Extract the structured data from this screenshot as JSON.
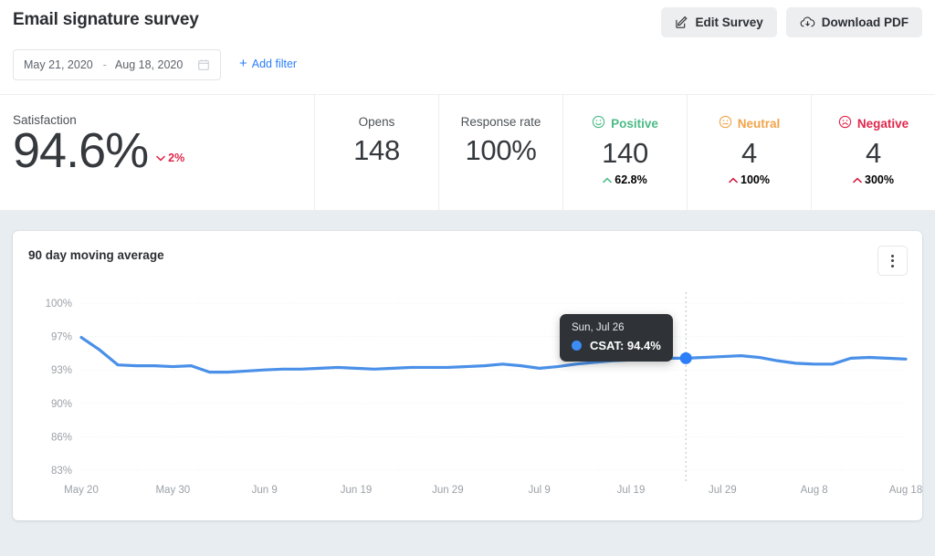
{
  "header": {
    "title": "Email signature survey",
    "edit_button": "Edit Survey",
    "download_button": "Download PDF",
    "edit_icon": "edit-pencil-square-icon",
    "download_icon": "cloud-download-icon"
  },
  "filters": {
    "start_date": "May 21, 2020",
    "end_date": "Aug 18, 2020",
    "separator": "-",
    "calendar_icon": "calendar-icon",
    "add_filter_label": "Add filter",
    "add_filter_plus": "+"
  },
  "metrics": {
    "satisfaction": {
      "label": "Satisfaction",
      "value": "94.6%",
      "delta": "2%",
      "delta_direction": "down",
      "delta_color": "#e0274b"
    },
    "cells": [
      {
        "label": "Opens",
        "value": "148",
        "icon": null,
        "sub": null
      },
      {
        "label": "Response rate",
        "value": "100%",
        "icon": null,
        "sub": null
      },
      {
        "label": "Positive",
        "value": "140",
        "icon": "smiley-happy-icon",
        "sub": "62.8%",
        "sub_direction": "up",
        "color": "#4cbb87",
        "sub_color": "#4cbb87"
      },
      {
        "label": "Neutral",
        "value": "4",
        "icon": "smiley-neutral-icon",
        "sub": "100%",
        "sub_direction": "up",
        "color": "#f0a44a",
        "sub_color": "#d41c3f"
      },
      {
        "label": "Negative",
        "value": "4",
        "icon": "smiley-sad-icon",
        "sub": "300%",
        "sub_direction": "up",
        "color": "#e0274b",
        "sub_color": "#d41c3f"
      }
    ]
  },
  "chart_card": {
    "title": "90 day moving average",
    "menu_icon": "kebab-menu-icon"
  },
  "tooltip": {
    "date": "Sun, Jul 26",
    "series_label": "CSAT: 94.4%",
    "dot_color": "#3b8cf4"
  },
  "chart_data": {
    "type": "line",
    "title": "90 day moving average",
    "xlabel": "",
    "ylabel": "",
    "series_name": "CSAT",
    "line_color": "#4a90e8",
    "grid": true,
    "legend": "none",
    "ylim": [
      83,
      100
    ],
    "ytick_labels": [
      "100%",
      "97%",
      "93%",
      "90%",
      "86%",
      "83%"
    ],
    "ytick_values": [
      100,
      97,
      93,
      90,
      86,
      83
    ],
    "xtick_labels": [
      "May 20",
      "May 30",
      "Jun 9",
      "Jun 19",
      "Jun 29",
      "Jul 9",
      "Jul 19",
      "Jul 29",
      "Aug 8",
      "Aug 18"
    ],
    "highlight_x": "Jul 26",
    "highlight_y": 94.4,
    "x": [
      "May 20",
      "May 22",
      "May 24",
      "May 26",
      "May 28",
      "May 30",
      "Jun 1",
      "Jun 3",
      "Jun 5",
      "Jun 7",
      "Jun 9",
      "Jun 11",
      "Jun 13",
      "Jun 15",
      "Jun 17",
      "Jun 19",
      "Jun 21",
      "Jun 23",
      "Jun 25",
      "Jun 27",
      "Jun 29",
      "Jul 1",
      "Jul 3",
      "Jul 5",
      "Jul 7",
      "Jul 9",
      "Jul 11",
      "Jul 13",
      "Jul 15",
      "Jul 17",
      "Jul 19",
      "Jul 21",
      "Jul 23",
      "Jul 26",
      "Jul 28",
      "Jul 30",
      "Aug 1",
      "Aug 3",
      "Aug 5",
      "Aug 7",
      "Aug 9",
      "Aug 11",
      "Aug 13",
      "Aug 15",
      "Aug 16",
      "Aug 18"
    ],
    "values": [
      96.9,
      95.4,
      93.6,
      93.5,
      93.5,
      93.4,
      93.5,
      92.8,
      92.8,
      92.9,
      93.0,
      93.1,
      93.1,
      93.2,
      93.3,
      93.2,
      93.1,
      93.2,
      93.3,
      93.3,
      93.3,
      93.4,
      93.5,
      93.7,
      93.5,
      93.2,
      93.4,
      93.7,
      93.9,
      94.1,
      94.2,
      94.3,
      94.4,
      94.4,
      94.5,
      94.6,
      94.7,
      94.5,
      94.1,
      93.8,
      93.7,
      93.7,
      94.4,
      94.5,
      94.4,
      94.3
    ]
  }
}
